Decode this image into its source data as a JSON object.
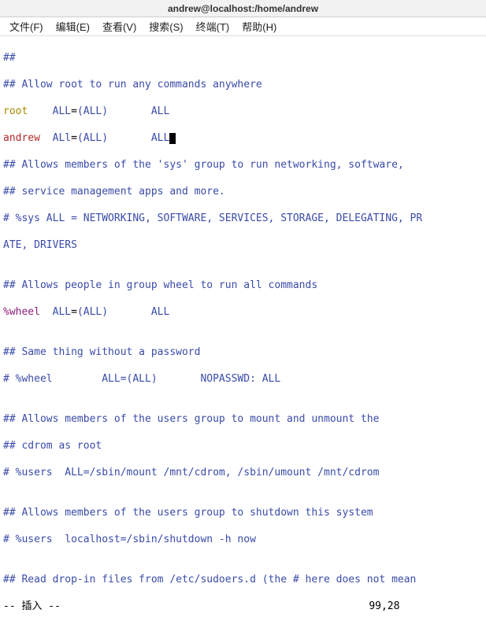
{
  "title": "andrew@localhost:/home/andrew",
  "menu": {
    "file": "文件(F)",
    "edit": "编辑(E)",
    "view": "查看(V)",
    "search": "搜索(S)",
    "terminal": "终端(T)",
    "help": "帮助(H)"
  },
  "lines": {
    "l01": "##",
    "l02": "## Allow root to run any commands anywhere",
    "l03a": "root",
    "l03b": "    ALL",
    "l03c": "=",
    "l03d": "(ALL)       ALL",
    "l04a": "andrew",
    "l04b": "  ALl",
    "l04c": "=",
    "l04d": "(ALL)       ALL",
    "l05": "## Allows members of the 'sys' group to run networking, software,",
    "l06": "## service management apps and more.",
    "l07": "# %sys ALL = NETWORKING, SOFTWARE, SERVICES, STORAGE, DELEGATING, PR",
    "l08": "ATE, DRIVERS",
    "l09": "",
    "l10": "## Allows people in group wheel to run all commands",
    "l11a": "%wheel",
    "l11b": "  ALL",
    "l11c": "=",
    "l11d": "(ALL)       ALL",
    "l12": "",
    "l13": "## Same thing without a password",
    "l14": "# %wheel        ALL=(ALL)       NOPASSWD: ALL",
    "l15": "",
    "l16": "## Allows members of the users group to mount and unmount the",
    "l17": "## cdrom as root",
    "l18": "# %users  ALL=/sbin/mount /mnt/cdrom, /sbin/umount /mnt/cdrom",
    "l19": "",
    "l20": "## Allows members of the users group to shutdown this system",
    "l21": "# %users  localhost=/sbin/shutdown -h now",
    "l22": "",
    "l23": "## Read drop-in files from /etc/sudoers.d (the # here does not mean"
  },
  "status": {
    "mode": "-- 插入 --",
    "pos": "99,28"
  }
}
